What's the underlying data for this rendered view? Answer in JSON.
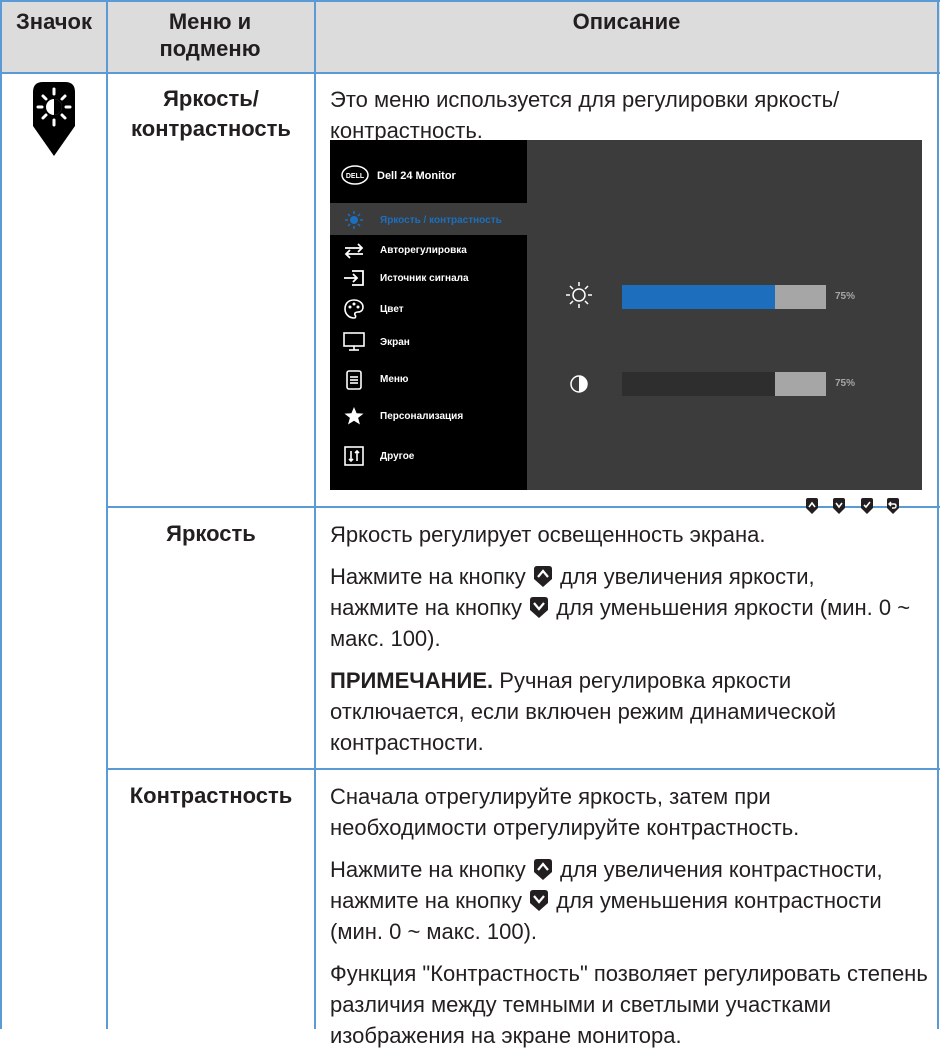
{
  "header": {
    "col1": "Значок",
    "col2": "Меню и подменю",
    "col3": "Описание"
  },
  "rows": {
    "brightness_contrast": {
      "submenu": "Яркость/ контрастность",
      "description": "Это меню используется для регулировки яркость/ контрастность."
    },
    "brightness": {
      "submenu": "Яркость",
      "p1": "Яркость регулирует освещенность экрана.",
      "p2_a": "Нажмите на кнопку",
      "p2_b": "для увеличения яркости,",
      "p2_c": "нажмите на кнопку",
      "p2_d": "для уменьшения яркости (мин. 0 ~ макс. 100).",
      "note_label": "ПРИМЕЧАНИЕ.",
      "note_text": "Ручная регулировка яркости отключается, если включен режим динамической контрастности."
    },
    "contrast": {
      "submenu": "Контрастность",
      "p1": "Сначала отрегулируйте яркость, затем при необходимости отрегулируйте контрастность.",
      "p2_a": "Нажмите на кнопку",
      "p2_b": "для увеличения контрастности,",
      "p2_c": "нажмите на кнопку",
      "p2_d": "для уменьшения контрастности (мин. 0 ~ макс. 100).",
      "p3": "Функция \"Контрастность\" позволяет регулировать степень различия между темными и светлыми участками изображения на экране монитора."
    }
  },
  "osd": {
    "logo": "DELL",
    "title": "Dell 24 Monitor",
    "menu": [
      {
        "label": "Яркость / контрастность",
        "icon": "sun-icon",
        "active": true
      },
      {
        "label": "Авторегулировка",
        "icon": "auto-adjust-icon"
      },
      {
        "label": "Источник сигнала",
        "icon": "input-source-icon"
      },
      {
        "label": "Цвет",
        "icon": "color-palette-icon"
      },
      {
        "label": "Экран",
        "icon": "display-icon"
      },
      {
        "label": "Меню",
        "icon": "menu-icon"
      },
      {
        "label": "Персонализация",
        "icon": "star-icon"
      },
      {
        "label": "Другое",
        "icon": "other-icon"
      }
    ],
    "brightness": {
      "value": 75,
      "label": "75%"
    },
    "contrast": {
      "value": 75,
      "label": "75%"
    },
    "colors": {
      "active": "#1d6fbd",
      "bar_bg": "#2e2e2e",
      "bar_fill": "#a6a6a6",
      "accent_text": "#1d6fbd"
    }
  }
}
